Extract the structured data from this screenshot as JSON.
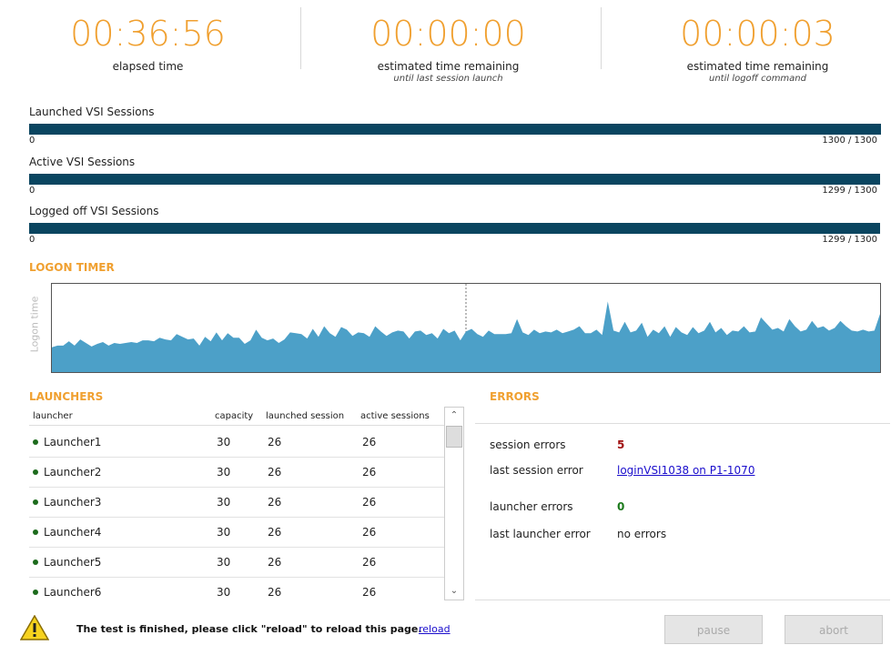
{
  "timers": [
    {
      "value": "00:36:56",
      "label": "elapsed time",
      "sub": ""
    },
    {
      "value": "00:00:00",
      "label": "estimated time remaining",
      "sub": "until last session launch"
    },
    {
      "value": "00:00:03",
      "label": "estimated time remaining",
      "sub": "until logoff command"
    }
  ],
  "progress": [
    {
      "title": "Launched VSI Sessions",
      "min": "0",
      "max_text": "1300 / 1300",
      "fraction": 1.0
    },
    {
      "title": "Active VSI Sessions",
      "min": "0",
      "max_text": "1299 / 1300",
      "fraction": 0.999
    },
    {
      "title": "Logged off VSI Sessions",
      "min": "0",
      "max_text": "1299 / 1300",
      "fraction": 0.999
    }
  ],
  "logon_timer": {
    "title": "LOGON TIMER",
    "ylabel": "Logon time",
    "color": "#4ca0c8"
  },
  "chart_data": {
    "type": "area",
    "title": "LOGON TIMER",
    "ylabel": "Logon time",
    "xlabel": "",
    "ylim": [
      0,
      100
    ],
    "values": [
      28,
      30,
      30,
      35,
      30,
      37,
      33,
      29,
      32,
      34,
      30,
      33,
      32,
      33,
      34,
      33,
      36,
      36,
      35,
      39,
      37,
      36,
      43,
      40,
      37,
      38,
      30,
      40,
      35,
      45,
      36,
      44,
      39,
      39,
      32,
      36,
      48,
      39,
      36,
      38,
      33,
      37,
      45,
      44,
      43,
      38,
      49,
      40,
      52,
      44,
      40,
      51,
      48,
      41,
      45,
      44,
      40,
      52,
      46,
      41,
      45,
      47,
      46,
      38,
      46,
      47,
      42,
      44,
      38,
      49,
      44,
      47,
      36,
      46,
      49,
      43,
      40,
      47,
      43,
      43,
      43,
      44,
      60,
      45,
      42,
      48,
      44,
      46,
      45,
      48,
      44,
      46,
      48,
      52,
      44,
      44,
      48,
      42,
      80,
      47,
      45,
      57,
      45,
      47,
      56,
      40,
      48,
      44,
      52,
      40,
      51,
      45,
      42,
      51,
      44,
      47,
      57,
      45,
      50,
      42,
      47,
      46,
      52,
      45,
      46,
      62,
      55,
      48,
      50,
      46,
      60,
      52,
      46,
      48,
      58,
      50,
      52,
      47,
      50,
      58,
      52,
      47,
      46,
      48,
      46,
      47,
      66
    ]
  },
  "launchers": {
    "title": "LAUNCHERS",
    "headers": [
      "launcher",
      "capacity",
      "launched session",
      "active sessions"
    ],
    "rows": [
      {
        "name": "Launcher1",
        "capacity": "30",
        "launched": "26",
        "active": "26"
      },
      {
        "name": "Launcher2",
        "capacity": "30",
        "launched": "26",
        "active": "26"
      },
      {
        "name": "Launcher3",
        "capacity": "30",
        "launched": "26",
        "active": "26"
      },
      {
        "name": "Launcher4",
        "capacity": "30",
        "launched": "26",
        "active": "26"
      },
      {
        "name": "Launcher5",
        "capacity": "30",
        "launched": "26",
        "active": "26"
      },
      {
        "name": "Launcher6",
        "capacity": "30",
        "launched": "26",
        "active": "26"
      }
    ],
    "status_color": "#1c6b1c"
  },
  "errors": {
    "title": "ERRORS",
    "session_errors_label": "session errors",
    "session_errors_value": "5",
    "last_session_error_label": "last session error",
    "last_session_error_value": "loginVSI1038 on P1-1070",
    "launcher_errors_label": "launcher errors",
    "launcher_errors_value": "0",
    "last_launcher_error_label": "last launcher error",
    "last_launcher_error_value": "no errors",
    "session_error_color": "#a01010",
    "launcher_error_color": "#1c7a1c"
  },
  "footer": {
    "message": "The test is finished, please click \"reload\" to reload this page.",
    "reload_label": "reload",
    "pause_label": "pause",
    "abort_label": "abort",
    "icon": "warning-icon"
  },
  "colors": {
    "accent": "#f0a030",
    "bar": "#0a4560",
    "link": "#1a0dcc"
  }
}
